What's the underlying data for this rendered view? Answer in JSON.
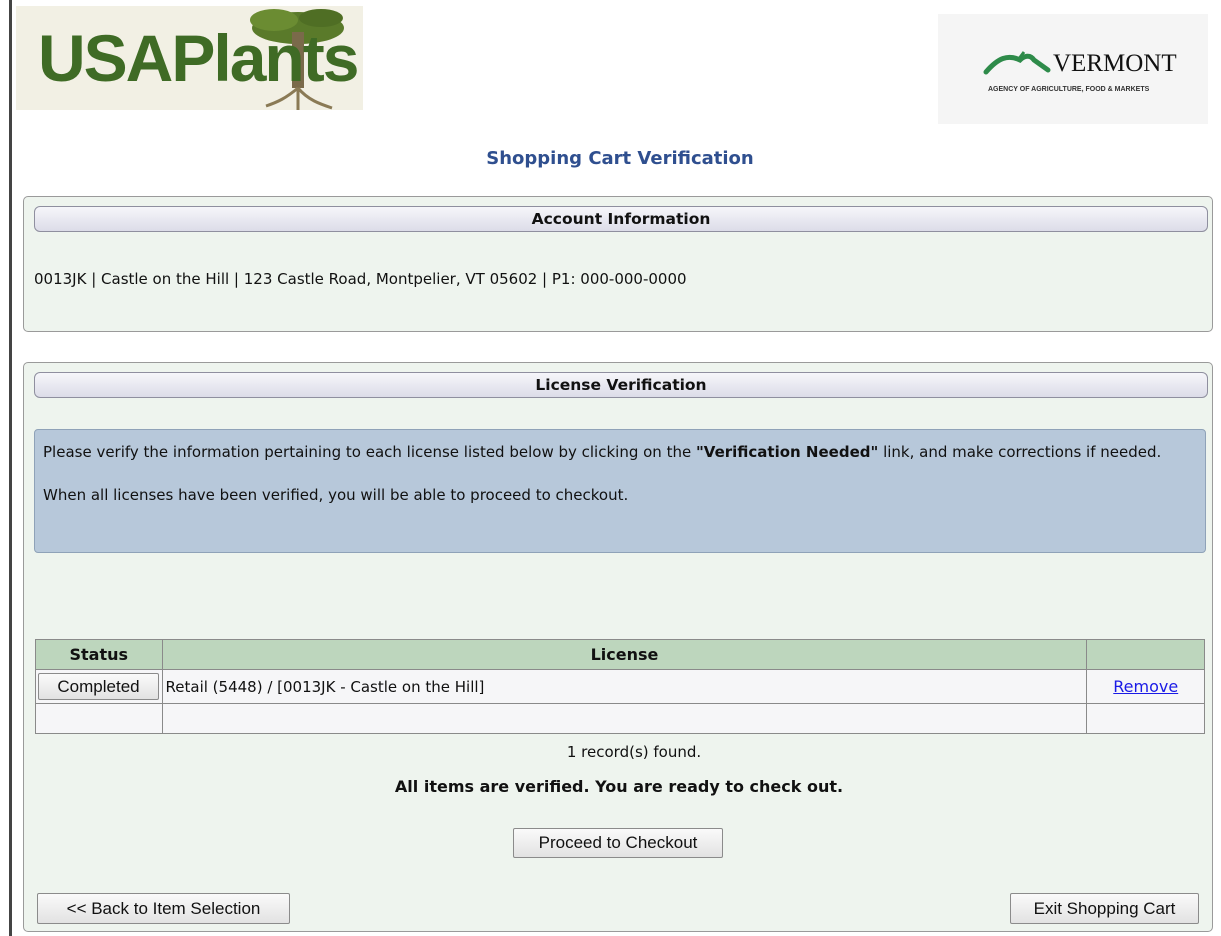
{
  "header": {
    "usa_plants_logo": "USAPlants",
    "vermont_logo": {
      "name": "VERMONT",
      "subtitle": "AGENCY OF AGRICULTURE, FOOD & MARKETS"
    }
  },
  "page_title": "Shopping Cart Verification",
  "account_panel": {
    "title": "Account Information",
    "info": "0013JK | Castle on the Hill | 123 Castle Road, Montpelier, VT 05602 | P1: 000-000-0000"
  },
  "license_panel": {
    "title": "License Verification",
    "notice": {
      "line1_pre": "Please verify the information pertaining to each license listed below by clicking on the ",
      "line1_bold": "\"Verification Needed\"",
      "line1_post": " link, and make corrections if needed.",
      "line2": "When all licenses have been verified, you will be able to proceed to checkout."
    },
    "table": {
      "headers": [
        "Status",
        "License",
        ""
      ],
      "rows": [
        {
          "status": "Completed",
          "license": "Retail (5448) / [0013JK - Castle on the Hill]",
          "action": "Remove"
        }
      ]
    },
    "records_found": "1 record(s) found.",
    "ready_message": "All items are verified. You are ready to check out.",
    "proceed_button": "Proceed to Checkout",
    "back_button": "<< Back to Item Selection",
    "exit_button": "Exit Shopping Cart"
  },
  "colors": {
    "title_blue": "#2f4f8f",
    "panel_bg": "#eef4ee",
    "notice_bg": "#b7c8da",
    "table_header_bg": "#bdd6bd",
    "link_blue": "#1a1ae6"
  }
}
